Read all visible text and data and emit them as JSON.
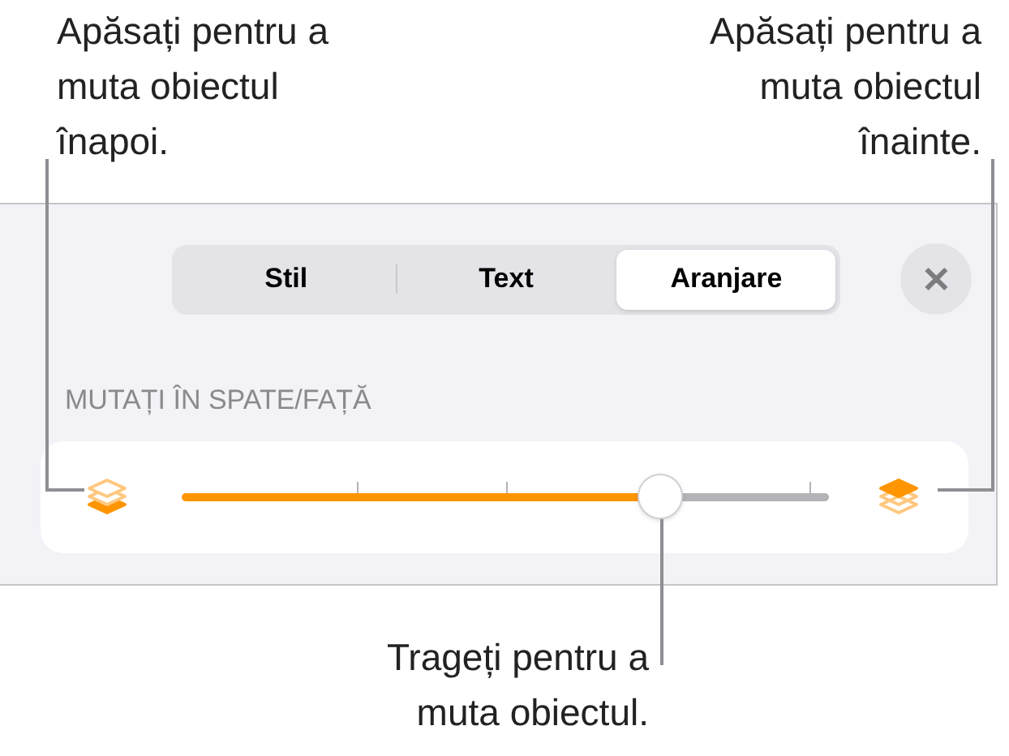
{
  "callouts": [
    {
      "kind": "left",
      "text": "Apăsați pentru a muta obiectul înapoi."
    },
    {
      "kind": "right",
      "text": "Apăsați pentru a muta obiectul înainte."
    },
    {
      "kind": "bottom",
      "text": "Trageți pentru a muta obiectul."
    }
  ],
  "tabs": [
    {
      "label": "Stil",
      "selected": false
    },
    {
      "label": "Text",
      "selected": false
    },
    {
      "label": "Aranjare",
      "selected": true
    }
  ],
  "close_button": {
    "label": "✕"
  },
  "section_label": "MUTAȚI ÎN SPATE/FAȚĂ",
  "slider": {
    "level": 0.74
  }
}
